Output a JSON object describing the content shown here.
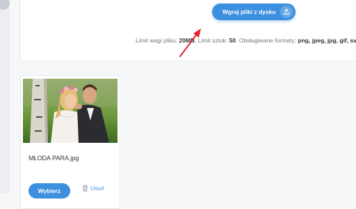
{
  "upload": {
    "button_label": "Wgraj pliki z dysku",
    "limits": {
      "size_label": "Limit wagi pliku: ",
      "size_value": "20MB",
      "count_label": ", Limit sztuk: ",
      "count_value": "50",
      "formats_label": ". Obsługiwane formaty: ",
      "formats_value": "png, jpeg, jpg, gif, svg."
    }
  },
  "files": [
    {
      "name": "MŁODA PARA.jpg",
      "choose_label": "Wybierz",
      "delete_label": "Usuń"
    }
  ],
  "colors": {
    "accent": "#3d8fe0",
    "annotation_arrow": "#e0262b"
  }
}
